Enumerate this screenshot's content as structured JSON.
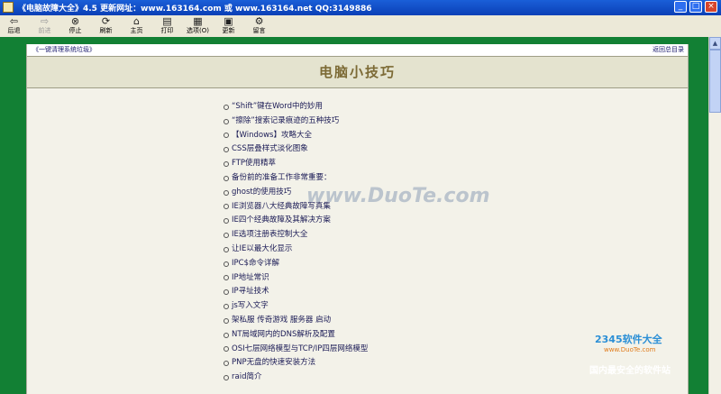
{
  "window": {
    "title": "《电脑故障大全》4.5   更新网址：www.163164.com 或 www.163164.net QQ:3149886"
  },
  "toolbar": [
    {
      "label": "后退",
      "icon": "back-arrow-icon",
      "glyph": "⇦",
      "enabled": true
    },
    {
      "label": "前进",
      "icon": "forward-arrow-icon",
      "glyph": "⇨",
      "enabled": false
    },
    {
      "label": "停止",
      "icon": "stop-icon",
      "glyph": "⊗",
      "enabled": true
    },
    {
      "label": "刷新",
      "icon": "refresh-icon",
      "glyph": "⟳",
      "enabled": true
    },
    {
      "label": "主页",
      "icon": "home-icon",
      "glyph": "⌂",
      "enabled": true
    },
    {
      "label": "打印",
      "icon": "print-icon",
      "glyph": "▤",
      "enabled": true
    },
    {
      "label": "选项(O)",
      "icon": "options-icon",
      "glyph": "▦",
      "enabled": true
    },
    {
      "label": "更新",
      "icon": "update-icon",
      "glyph": "▣",
      "enabled": true
    },
    {
      "label": "留言",
      "icon": "message-icon",
      "glyph": "⚙",
      "enabled": true
    }
  ],
  "page": {
    "top_left_link": "《一键清理系统垃圾》",
    "top_right_link": "返回总目录",
    "heading": "电脑小技巧",
    "links": [
      "“Shift”键在Word中的妙用",
      "“擦除”搜索记录痕迹的五种技巧",
      "【Windows】攻略大全",
      "CSS层叠样式淡化图象",
      "FTP使用精萃",
      "备份前的准备工作非常重要：",
      "ghost的使用技巧",
      "IE浏览器八大经典故障写真集",
      "IE四个经典故障及其解决方案",
      "IE选项注册表控制大全",
      "让IE以最大化显示",
      "IPC$命令详解",
      "IP地址常识",
      "IP寻址技术",
      "js写入文字",
      "架私服 传奇游戏 服务器 启动",
      "NT局域网内的DNS解析及配置",
      "OSI七层网络模型与TCP/IP四层网络模型",
      "PNP无盘的快速安装方法",
      "raid简介"
    ]
  },
  "watermarks": {
    "duote": "www.DuoTe.com",
    "brand": "2345软件大全",
    "brand_url": "www.DuoTe.com",
    "slogan": "国内最安全的软件站"
  },
  "colors": {
    "frame_green": "#128034",
    "page_bg": "#f3f2e9",
    "heading_color": "#7c6a35",
    "link_color": "#1a1a55"
  }
}
